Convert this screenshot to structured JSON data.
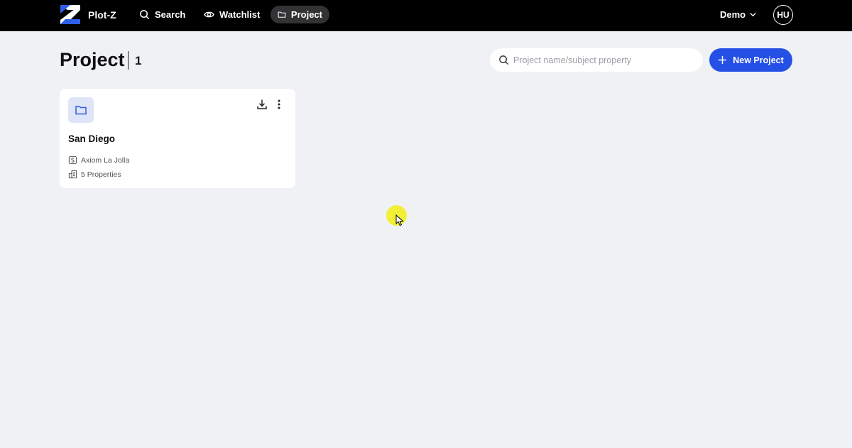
{
  "brand": {
    "name": "Plot-Z",
    "logo_icon": "plotz-logo",
    "logo_colors": [
      "#ffffff",
      "#2f5ee8"
    ]
  },
  "nav": {
    "items": [
      {
        "label": "Search",
        "icon": "search-icon",
        "active": false
      },
      {
        "label": "Watchlist",
        "icon": "eye-icon",
        "active": false
      },
      {
        "label": "Project",
        "icon": "folder-icon",
        "active": true
      }
    ],
    "workspace": {
      "label": "Demo",
      "icon": "chevron-down-icon"
    },
    "user_initials": "HU"
  },
  "header": {
    "title": "Project",
    "count": "1",
    "search_placeholder": "Project name/subject property",
    "search_value": "",
    "new_button_label": "New Project"
  },
  "projects": [
    {
      "name": "San Diego",
      "subject_property": "Axiom La Jolla",
      "properties": "5 Properties"
    }
  ],
  "colors": {
    "topbar": "#000000",
    "page_bg": "#f0f1f5",
    "accent": "#2550e6",
    "folder_tile": "#dfe5f7",
    "cursor_highlight": "#f2f014"
  }
}
